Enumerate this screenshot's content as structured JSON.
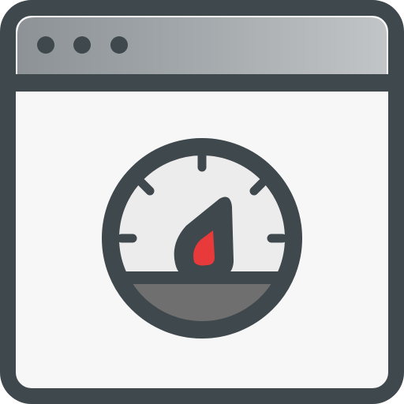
{
  "icon": {
    "name": "browser-speed-gauge-icon",
    "colors": {
      "outline": "#3f484d",
      "title_bar": "#aeb3b6",
      "title_bar_shade": "#8e9397",
      "window_body": "#f7f7f7",
      "gauge_face": "#ececec",
      "gauge_base": "#6f6f6f",
      "needle": "#e83a3a",
      "dots": "#3f484d"
    }
  }
}
